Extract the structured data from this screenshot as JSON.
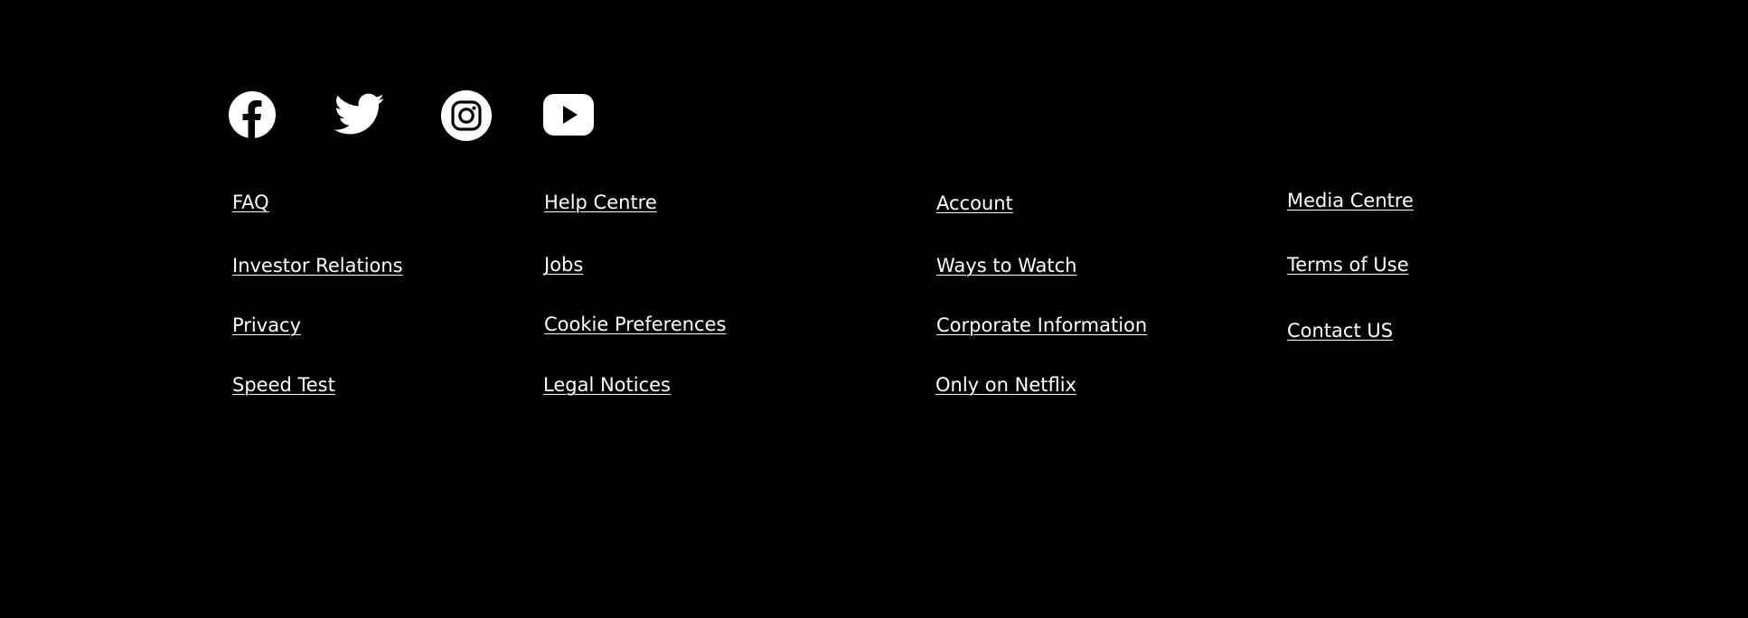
{
  "colors": {
    "background": "#000000",
    "text": "#ffffff"
  },
  "social": [
    {
      "icon": "facebook-icon"
    },
    {
      "icon": "twitter-icon"
    },
    {
      "icon": "instagram-icon"
    },
    {
      "icon": "youtube-icon"
    }
  ],
  "links": {
    "col1": [
      "FAQ",
      "Investor Relations",
      "Privacy",
      "Speed Test"
    ],
    "col2": [
      "Help Centre",
      "Jobs",
      "Cookie Preferences",
      "Legal Notices"
    ],
    "col3": [
      "Account",
      "Ways to Watch",
      "Corporate Information",
      "Only on Netflix"
    ],
    "col4": [
      "Media Centre",
      "Terms of Use",
      "Contact US"
    ]
  }
}
